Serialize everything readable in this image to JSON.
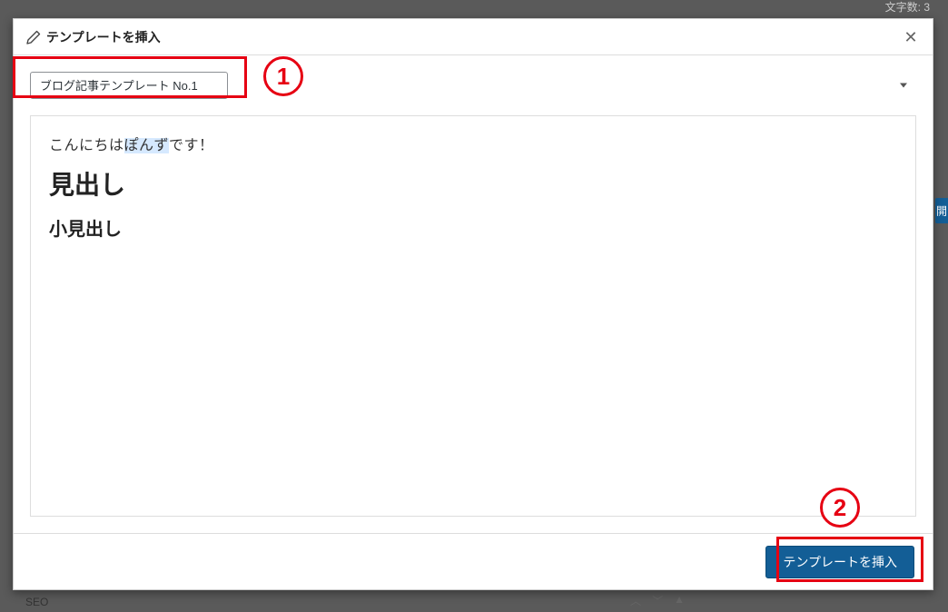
{
  "background": {
    "char_count_label": "文字数: 3",
    "side_tab": "開",
    "seo_label": "SEO"
  },
  "modal": {
    "title": "テンプレートを挿入",
    "close_symbol": "✕",
    "template_selected": "ブログ記事テンプレート No.1",
    "footer": {
      "insert_label": "テンプレートを挿入"
    },
    "preview": {
      "intro_prefix": "こんにちは",
      "intro_highlight": "ぽんず",
      "intro_suffix": "です！",
      "heading": "見出し",
      "subheading": "小見出し"
    }
  },
  "annotations": {
    "marker1": "1",
    "marker2": "2"
  }
}
